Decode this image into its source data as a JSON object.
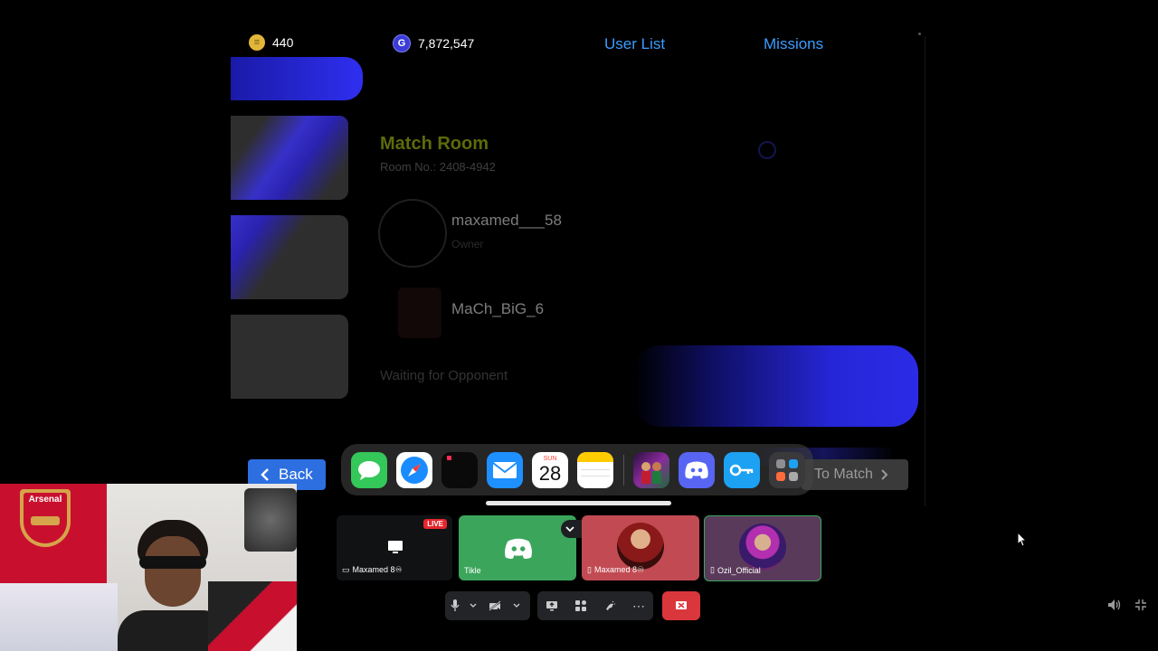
{
  "top_bar": {
    "coins": "440",
    "gp": "7,872,547",
    "user_list": "User List",
    "missions": "Missions"
  },
  "room": {
    "title": "Match Room",
    "room_no": "Room No.: 2408-4942",
    "player1": "maxamed___58",
    "player1_role": "Owner",
    "player2": "MaCh_BiG_6",
    "waiting": "Waiting for Opponent"
  },
  "buttons": {
    "back": "Back",
    "to_match": "To Match"
  },
  "dock": {
    "calendar_day": "SUN",
    "calendar_date": "28",
    "icons": [
      "messages-icon",
      "safari-icon",
      "app-icon",
      "mail-icon",
      "calendar-icon",
      "notes-icon",
      "game-icon",
      "discord-icon",
      "key-icon",
      "folder-icon"
    ]
  },
  "call": {
    "tiles": [
      {
        "label": "Maxamed 8♾",
        "badge": "LIVE"
      },
      {
        "label": "Tikle"
      },
      {
        "label": "Maxamed 8♾"
      },
      {
        "label": "Ozil_Official"
      }
    ]
  },
  "webcam": {
    "banner": "Arsenal"
  },
  "colors": {
    "accent_blue": "#2d6fe0",
    "discord_green": "#3ba55c",
    "end_call_red": "#da373c"
  }
}
